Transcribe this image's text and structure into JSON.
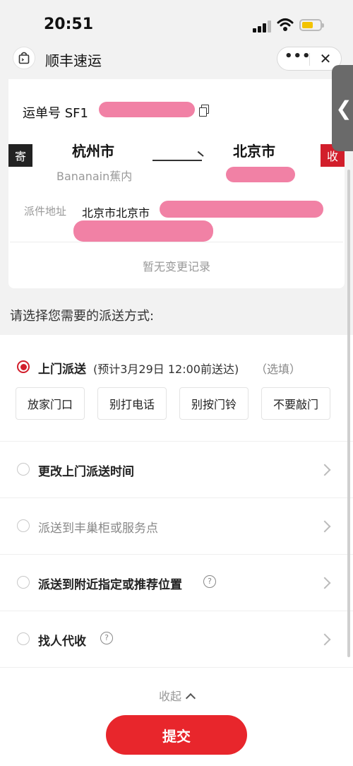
{
  "status_bar": {
    "time": "20:51"
  },
  "header": {
    "title": "顺丰速运",
    "more": "•••",
    "close": "✕"
  },
  "waybill": {
    "label": "运单号 SF1"
  },
  "route": {
    "send_tag": "寄",
    "recv_tag": "收",
    "from_city": "杭州市",
    "to_city": "北京市",
    "sender_name": "Bananain蕉内"
  },
  "address": {
    "label": "派件地址",
    "value": "北京市北京市"
  },
  "change_record": "暂无变更记录",
  "delivery": {
    "title": "请选择您需要的派送方式:",
    "options": [
      {
        "label": "上门派送",
        "note": "(预计3月29日 12:00前送达)",
        "optional": "（选填）",
        "selected": true
      },
      {
        "label": "更改上门派送时间",
        "selected": false
      },
      {
        "label": "派送到丰巢柜或服务点",
        "selected": false
      },
      {
        "label": "派送到附近指定或推荐位置",
        "selected": false
      },
      {
        "label": "找人代收",
        "selected": false
      }
    ],
    "chips": [
      "放家门口",
      "别打电话",
      "别按门铃",
      "不要敲门"
    ]
  },
  "collapse_label": "收起",
  "submit_label": "提交",
  "side_tab_label": "❮",
  "colors": {
    "accent": "#e8262c",
    "dark_tag": "#222222",
    "redaction": "#f07aa0"
  }
}
